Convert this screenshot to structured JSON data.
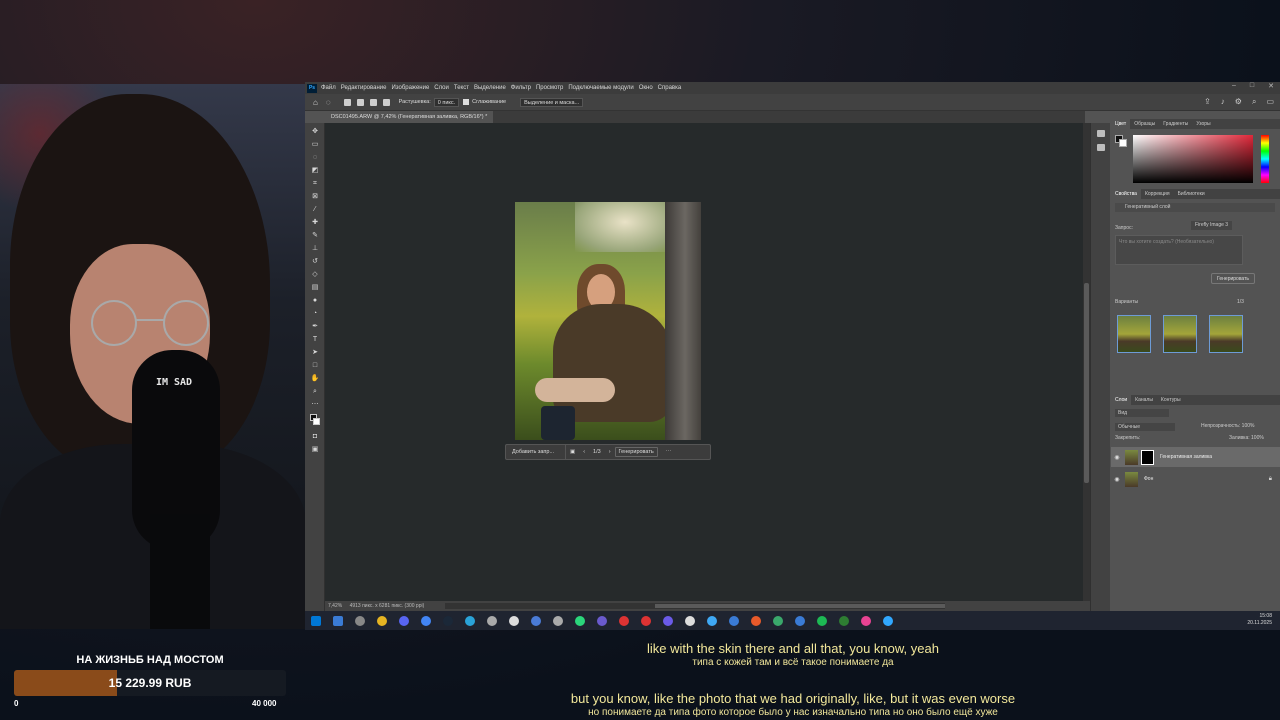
{
  "ps": {
    "menu": [
      "Файл",
      "Редактирование",
      "Изображение",
      "Слои",
      "Текст",
      "Выделение",
      "Фильтр",
      "Просмотр",
      "Подключаемые модули",
      "Окно",
      "Справка"
    ],
    "app_logo": "Ps",
    "options": {
      "feather_label": "Растушевка:",
      "feather_value": "0 пикс.",
      "antialias_label": "Сглаживание",
      "select_mask_button": "Выделение и маска..."
    },
    "doc_tab": "DSC01495.ARW @ 7,42% (Генеративная заливка, RGB/16*) *",
    "status": "7,42%",
    "status_info": "4913 пикс. x 6281 пикс. (300 ppi)",
    "contextual_bar": {
      "prompt_placeholder": "Добавить запр...",
      "page": "1/3",
      "generate": "Генерировать"
    }
  },
  "panels": {
    "color_tabs": [
      "Цвет",
      "Образцы",
      "Градиенты",
      "Узоры"
    ],
    "props_tabs": [
      "Свойства",
      "Коррекция",
      "Библиотеки"
    ],
    "layer_type": "Генеративный слой",
    "model": "Firefly Image 3",
    "prompt_label": "Запрос:",
    "prompt_placeholder": "Что вы хотите создать? (Необязательно)",
    "generate_button": "Генерировать",
    "variants_label": "Варианты",
    "variants_count": "1/3",
    "layers_tabs": [
      "Слои",
      "Каналы",
      "Контуры"
    ],
    "filter": "Вид",
    "blend_mode": "Обычные",
    "opacity": "Непрозрачность: 100%",
    "lock": "Закрепить:",
    "fill": "Заливка: 100%",
    "layers": [
      {
        "name": "Генеративная заливка"
      },
      {
        "name": "Фон"
      }
    ]
  },
  "taskbar": {
    "time": "15:08",
    "date": "20.11.2025",
    "app_colors": [
      "#0078d7",
      "#3a7bd5",
      "#888",
      "#e6b422",
      "#5865f2",
      "#4285f4",
      "#1b2838",
      "#2aa3d8",
      "#aaa",
      "#ddd",
      "#4a7bd6",
      "#aaa",
      "#2bd67b",
      "#6a5acd",
      "#d33",
      "#d33",
      "#6b5be8",
      "#ddd",
      "#3fa9f5",
      "#3a7bd5",
      "#e85a2a",
      "#3aa86b",
      "#3a7bd5",
      "#1db954",
      "#2e7d32",
      "#e84393",
      "#31a8ff"
    ]
  },
  "donation": {
    "title": "НА ЖИЗНЬБ НАД МОСТОМ",
    "amount": "15 229.99 RUB",
    "min": "0",
    "max": "40 000",
    "progress_fraction": 0.38
  },
  "subtitles": [
    {
      "en": "like with the skin there and all that, you know, yeah",
      "ru": "типа с кожей там и всё такое понимаете да"
    },
    {
      "en": "but you know, like the photo that we had originally, like, but it was even worse",
      "ru": "но понимаете да типа фото которое было у нас изначально типа но оно было ещё хуже"
    }
  ],
  "webcam": {
    "mic_label": "IM SAD"
  },
  "colors": {
    "ps_bg": "#535353",
    "canvas_bg": "#262a2b",
    "subtitle": "#f2e79a",
    "donation_fill": "#8a4b1a"
  }
}
